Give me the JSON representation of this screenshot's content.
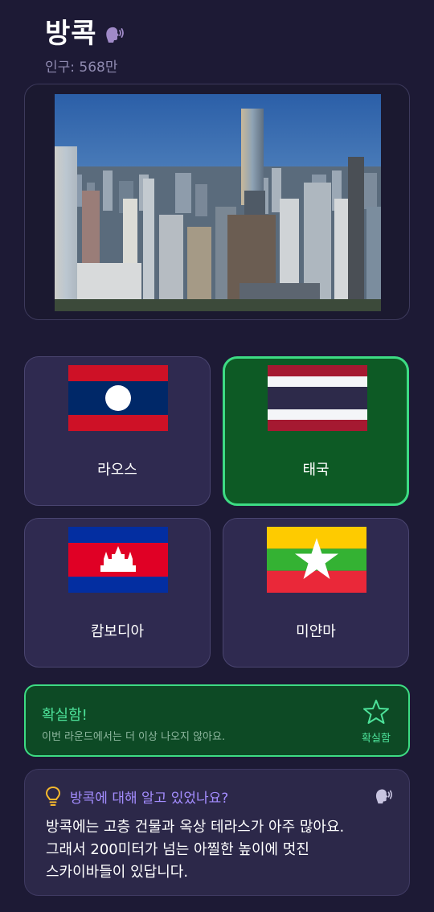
{
  "header": {
    "city": "방콕",
    "population": "인구: 568만",
    "speaker_icon": "speaking-head-icon"
  },
  "photo": {
    "subject": "bangkok-skyline-icon"
  },
  "options": [
    {
      "label": "라오스",
      "flag": "laos-flag-icon",
      "state": "default"
    },
    {
      "label": "태국",
      "flag": "thailand-flag-icon",
      "state": "correct"
    },
    {
      "label": "캄보디아",
      "flag": "cambodia-flag-icon",
      "state": "default"
    },
    {
      "label": "미얀마",
      "flag": "myanmar-flag-icon",
      "state": "default"
    }
  ],
  "result": {
    "title": "확실함!",
    "subtitle": "이번 라운드에서는 더 이상 나오지 않아요.",
    "star_label": "확실함"
  },
  "fact": {
    "title": "방콕에 대해 알고 있었나요?",
    "line1": "방콕에는 고층 건물과 옥상 테라스가 아주 많아요.",
    "line2": "그래서 200미터가 넘는 아찔한 높이에 멋진",
    "line3": "스카이바들이 있답니다."
  },
  "colors": {
    "background": "#1d1a35",
    "card": "#2f2a50",
    "correct_bg": "#0d5a25",
    "correct_border": "#3ddc84",
    "accent_purple": "#a48dff"
  }
}
